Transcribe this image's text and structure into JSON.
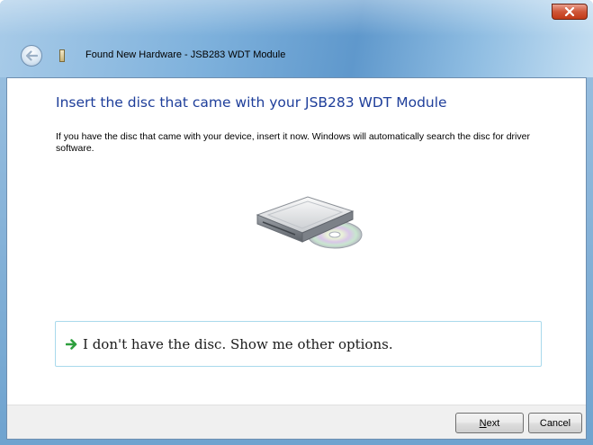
{
  "window": {
    "title": "Found New Hardware - JSB283 WDT Module"
  },
  "main": {
    "heading": "Insert the disc that came with your JSB283 WDT Module",
    "instructions": "If you have the disc that came with your device, insert it now.  Windows will automatically search the disc for driver software.",
    "option_text": "I don't have the disc.  Show me other options."
  },
  "footer": {
    "next_mnemonic": "N",
    "next_rest": "ext",
    "cancel_label": "Cancel"
  },
  "colors": {
    "heading": "#1e3e9a",
    "option_border": "#a9d9ec",
    "arrow_green": "#2e9f3e",
    "close_red": "#c23a17"
  },
  "icons": [
    "back-arrow-icon",
    "hardware-device-icon",
    "close-icon",
    "disc-drive-icon",
    "green-arrow-icon"
  ]
}
